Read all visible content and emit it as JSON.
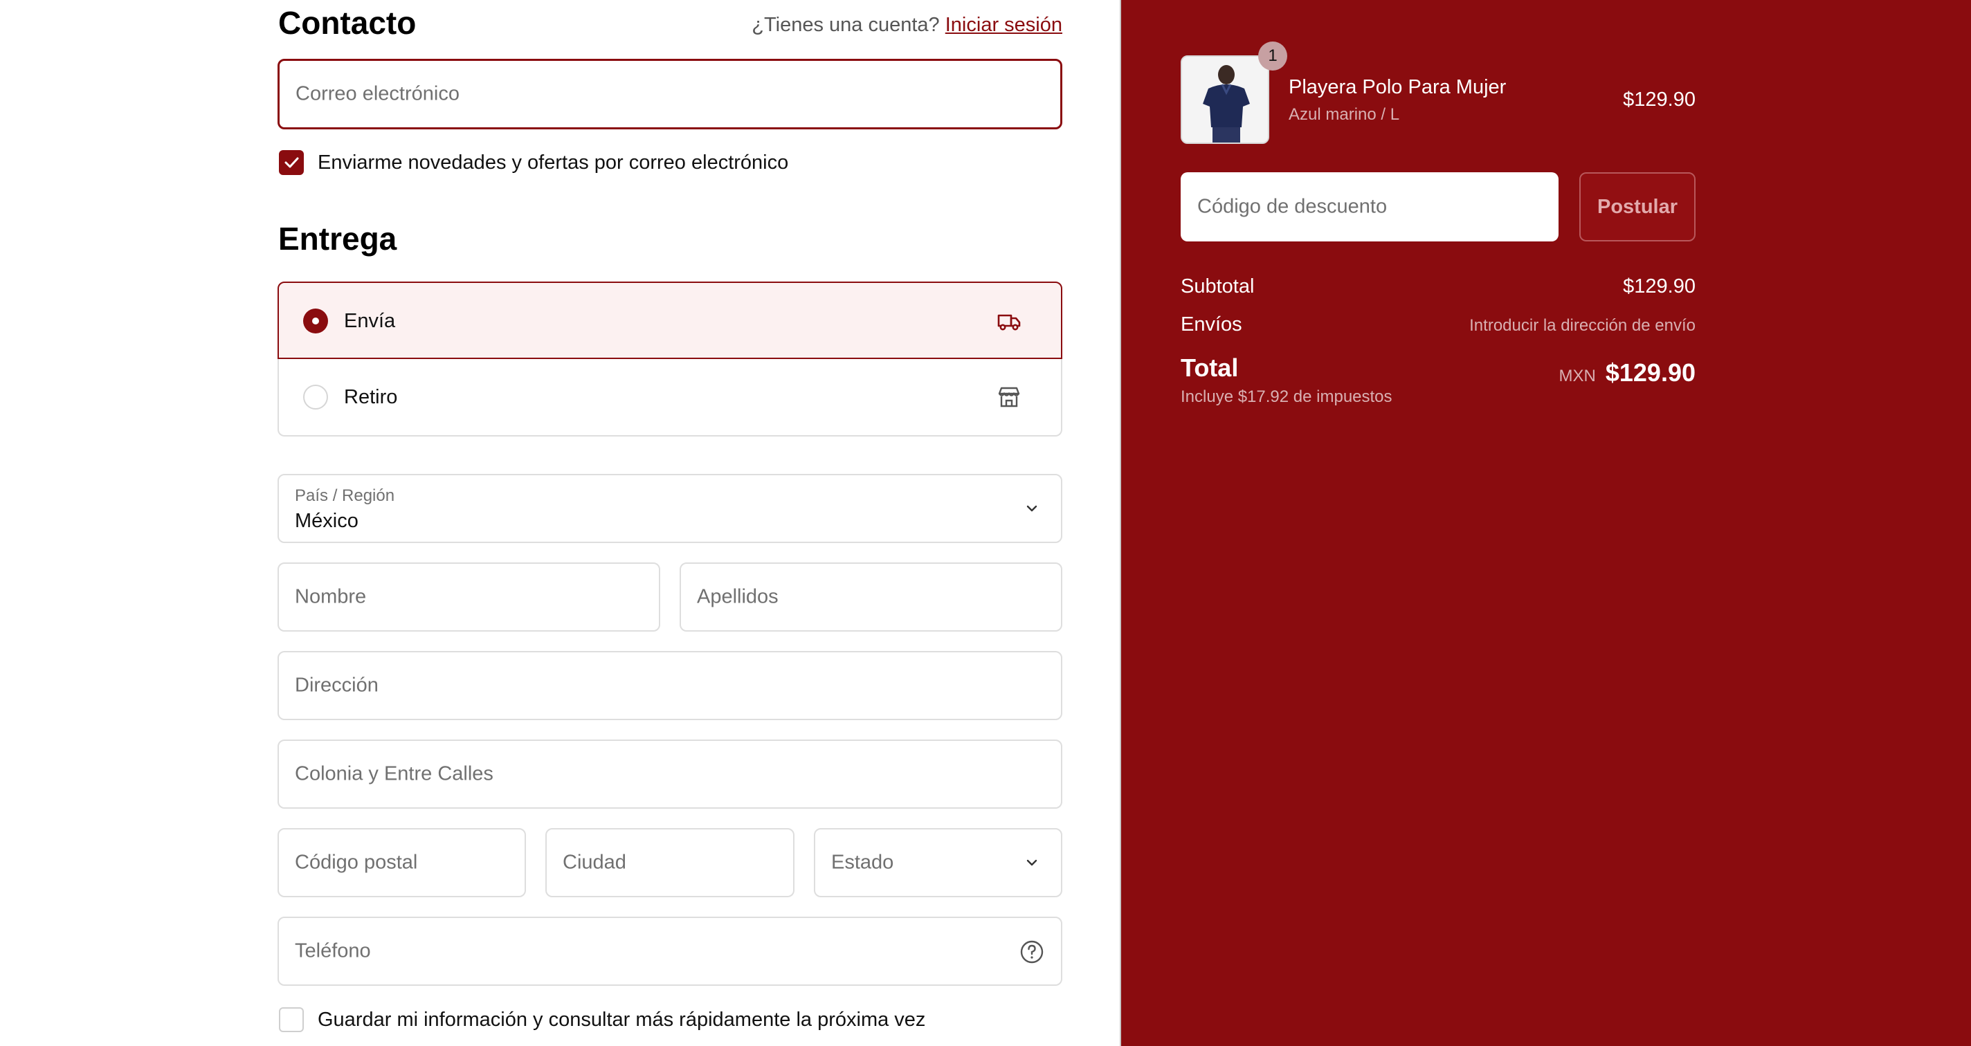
{
  "contact": {
    "title": "Contacto",
    "account_prompt": "¿Tienes una cuenta?",
    "login_link": "Iniciar sesión",
    "email_placeholder": "Correo electrónico",
    "newsletter_label": "Enviarme novedades y ofertas por correo electrónico",
    "newsletter_checked": true
  },
  "delivery": {
    "title": "Entrega",
    "options": [
      {
        "label": "Envía",
        "selected": true,
        "icon": "truck-icon"
      },
      {
        "label": "Retiro",
        "selected": false,
        "icon": "store-icon"
      }
    ],
    "country_label": "País / Región",
    "country_value": "México",
    "first_name_placeholder": "Nombre",
    "last_name_placeholder": "Apellidos",
    "address_placeholder": "Dirección",
    "colony_placeholder": "Colonia y Entre Calles",
    "postal_placeholder": "Código postal",
    "city_placeholder": "Ciudad",
    "state_placeholder": "Estado",
    "phone_placeholder": "Teléfono",
    "save_info_label": "Guardar mi información y consultar más rápidamente la próxima vez",
    "save_info_checked": false
  },
  "summary": {
    "product": {
      "quantity": "1",
      "name": "Playera Polo Para Mujer",
      "variant": "Azul marino / L",
      "price": "$129.90"
    },
    "discount_placeholder": "Código de descuento",
    "apply_label": "Postular",
    "subtotal_label": "Subtotal",
    "subtotal_value": "$129.90",
    "shipping_label": "Envíos",
    "shipping_value": "Introducir la dirección de envío",
    "total_label": "Total",
    "taxes_note": "Incluye $17.92 de impuestos",
    "currency": "MXN",
    "total_value": "$129.90"
  },
  "colors": {
    "accent": "#8a0c0f",
    "selected_bg": "#fcf1f1"
  }
}
